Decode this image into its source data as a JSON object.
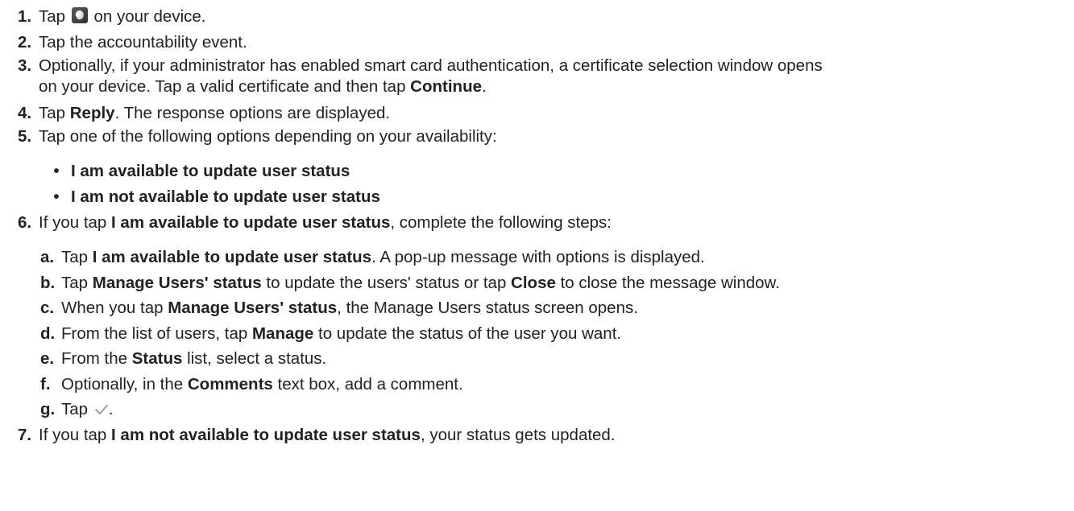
{
  "steps": [
    {
      "num": "1.",
      "parts": [
        "Tap ",
        "[app-icon]",
        " on your device."
      ]
    },
    {
      "num": "2.",
      "parts": [
        "Tap the accountability event."
      ]
    },
    {
      "num": "3.",
      "line1": "Optionally, if your administrator has enabled smart card authentication, a certificate selection window opens",
      "line2_a": "on your device. Tap a valid certificate and then tap ",
      "line2_b": "Continue",
      "line2_c": "."
    },
    {
      "num": "4.",
      "a": "Tap ",
      "b": "Reply",
      "c": ". The response options are displayed."
    },
    {
      "num": "5.",
      "text": "Tap one of the following options depending on your availability:"
    },
    {
      "num": "6.",
      "a": "If you tap ",
      "b": "I am available to update user status",
      "c": ", complete the following steps:"
    },
    {
      "num": "7.",
      "a": "If you tap ",
      "b": "I am not available to update user status",
      "c": ", your status gets updated."
    }
  ],
  "bullets": [
    {
      "dot": "•",
      "text": "I am available to update user status"
    },
    {
      "dot": "•",
      "text": "I am not available to update user status"
    }
  ],
  "substeps": {
    "a": {
      "lbl": "a.",
      "t1": "Tap ",
      "b1": "I am available to update user status",
      "t2": ". A pop-up message with options is displayed."
    },
    "b": {
      "lbl": "b.",
      "t1": "Tap ",
      "b1": "Manage Users' status",
      "t2": " to update the users' status or tap ",
      "b2": "Close",
      "t3": " to close the message window."
    },
    "c": {
      "lbl": "c.",
      "t1": "When you tap ",
      "b1": "Manage Users' status",
      "t2": ", the Manage Users status screen opens."
    },
    "d": {
      "lbl": "d.",
      "t1": "From the list of users, tap ",
      "b1": "Manage",
      "t2": " to update the status of the user you want."
    },
    "e": {
      "lbl": "e.",
      "t1": "From the ",
      "b1": "Status",
      "t2": " list, select a status."
    },
    "f": {
      "lbl": "f.",
      "t1": "Optionally, in the ",
      "b1": "Comments",
      "t2": " text box, add a comment."
    },
    "g": {
      "lbl": "g.",
      "t1": "Tap ",
      "t2": "."
    }
  },
  "icons": {
    "app_icon": "app-launcher-icon",
    "check_icon": "checkmark-icon",
    "check_color": "#9aa0a6"
  }
}
